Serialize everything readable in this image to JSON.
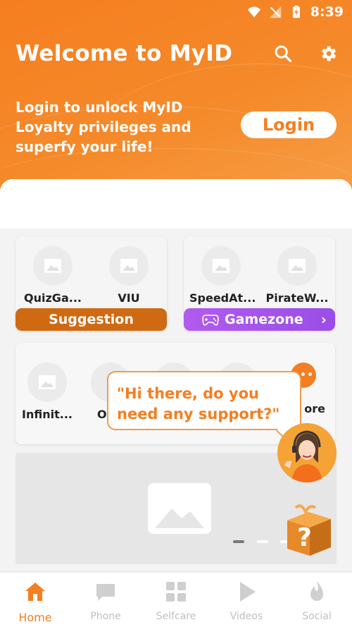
{
  "status_bar": {
    "time": "8:39"
  },
  "header": {
    "title": "Welcome to MyID",
    "promo_text": "Login to unlock MyID Loyalty privileges and superfy your life!",
    "login_label": "Login",
    "search_icon": "search-icon",
    "settings_icon": "gear-icon"
  },
  "suggestion_card": {
    "apps": [
      {
        "label": "QuizGa..."
      },
      {
        "label": "VIU"
      }
    ],
    "button_label": "Suggestion"
  },
  "game_card": {
    "apps": [
      {
        "label": "SpeedAt..."
      },
      {
        "label": "PirateW..."
      }
    ],
    "button_label": "Gamezone"
  },
  "services_row": {
    "apps": [
      {
        "label": "Infinit..."
      },
      {
        "label": "O"
      },
      {
        "label": ""
      },
      {
        "label": ""
      },
      {
        "label": "ore"
      }
    ]
  },
  "support_bubble": {
    "text": "\"Hi there, do you need any support?\""
  },
  "nav": {
    "items": [
      {
        "label": "Home",
        "icon": "home-icon",
        "active": true
      },
      {
        "label": "Phone",
        "icon": "chat-bubble-icon",
        "active": false
      },
      {
        "label": "Selfcare",
        "icon": "grid-icon",
        "active": false
      },
      {
        "label": "Videos",
        "icon": "play-icon",
        "active": false
      },
      {
        "label": "Social",
        "icon": "flame-icon",
        "active": false
      }
    ]
  },
  "colors": {
    "brand_orange": "#f57e20",
    "suggestion_brown": "#d06a12",
    "gamezone_purple": "#a854ec"
  }
}
